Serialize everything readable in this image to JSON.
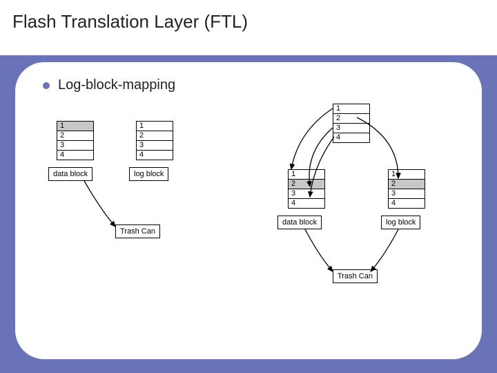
{
  "title": "Flash Translation Layer (FTL)",
  "bullet": "Log-block-mapping",
  "labels": {
    "data_block": "data block",
    "log_block": "log block",
    "trash_can": "Trash Can"
  },
  "tables": {
    "left_data": {
      "rows": [
        "1",
        "2",
        "3",
        "4"
      ],
      "shaded": [
        0
      ]
    },
    "left_log": {
      "rows": [
        "1",
        "2",
        "3",
        "4"
      ],
      "shaded": []
    },
    "right_top": {
      "rows": [
        "1",
        "2",
        "3",
        "4"
      ],
      "shaded": []
    },
    "right_data": {
      "rows": [
        "1",
        "2",
        "3",
        "4"
      ],
      "shaded": [
        1
      ]
    },
    "right_log": {
      "rows": [
        "1",
        "2",
        "3",
        "4"
      ],
      "shaded": [
        1
      ]
    }
  }
}
